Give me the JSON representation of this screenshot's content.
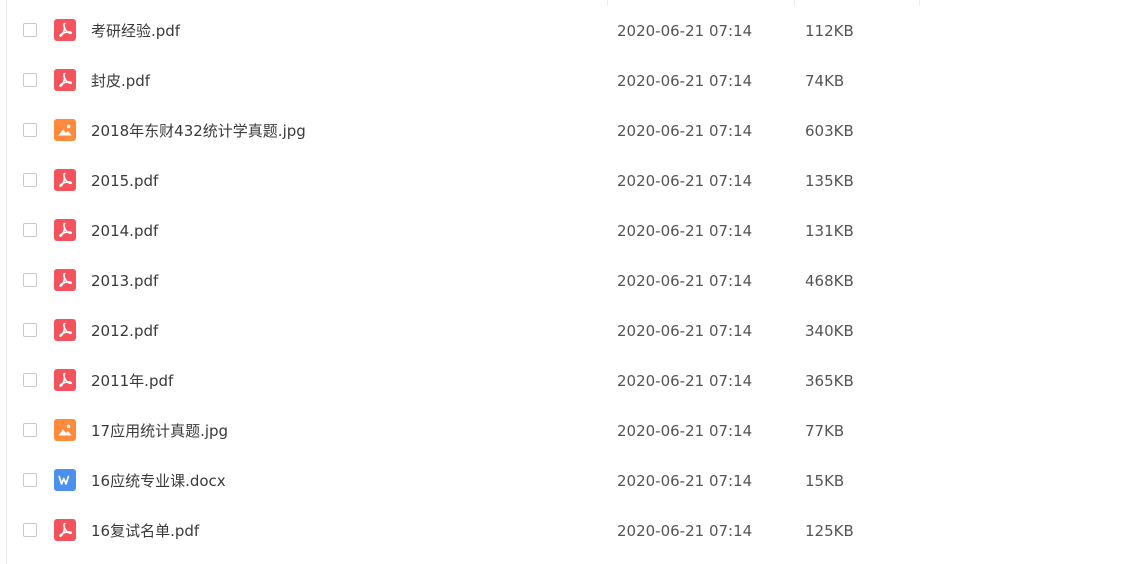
{
  "files": [
    {
      "name": "考研经验.pdf",
      "type": "pdf",
      "icon": "pdf-file-icon",
      "date": "2020-06-21 07:14",
      "size": "112KB"
    },
    {
      "name": "封皮.pdf",
      "type": "pdf",
      "icon": "pdf-file-icon",
      "date": "2020-06-21 07:14",
      "size": "74KB"
    },
    {
      "name": "2018年东财432统计学真题.jpg",
      "type": "image",
      "icon": "image-file-icon",
      "date": "2020-06-21 07:14",
      "size": "603KB"
    },
    {
      "name": "2015.pdf",
      "type": "pdf",
      "icon": "pdf-file-icon",
      "date": "2020-06-21 07:14",
      "size": "135KB"
    },
    {
      "name": "2014.pdf",
      "type": "pdf",
      "icon": "pdf-file-icon",
      "date": "2020-06-21 07:14",
      "size": "131KB"
    },
    {
      "name": "2013.pdf",
      "type": "pdf",
      "icon": "pdf-file-icon",
      "date": "2020-06-21 07:14",
      "size": "468KB"
    },
    {
      "name": "2012.pdf",
      "type": "pdf",
      "icon": "pdf-file-icon",
      "date": "2020-06-21 07:14",
      "size": "340KB"
    },
    {
      "name": "2011年.pdf",
      "type": "pdf",
      "icon": "pdf-file-icon",
      "date": "2020-06-21 07:14",
      "size": "365KB"
    },
    {
      "name": "17应用统计真题.jpg",
      "type": "image",
      "icon": "image-file-icon",
      "date": "2020-06-21 07:14",
      "size": "77KB"
    },
    {
      "name": "16应统专业课.docx",
      "type": "word",
      "icon": "word-file-icon",
      "date": "2020-06-21 07:14",
      "size": "15KB"
    },
    {
      "name": "16复试名单.pdf",
      "type": "pdf",
      "icon": "pdf-file-icon",
      "date": "2020-06-21 07:14",
      "size": "125KB"
    }
  ],
  "colors": {
    "pdf": "#f4525d",
    "image": "#ff8a3c",
    "word": "#4a90ee"
  }
}
